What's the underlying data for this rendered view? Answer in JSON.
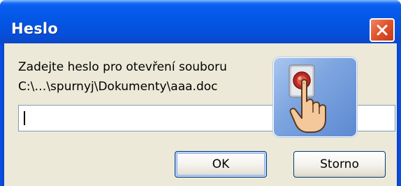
{
  "window": {
    "title": "Heslo"
  },
  "prompt": {
    "line1": "Zadejte heslo pro otevření souboru",
    "line2": "C:\\…\\spurnyj\\Dokumenty\\aaa.doc"
  },
  "password": {
    "value": "",
    "placeholder": ""
  },
  "buttons": {
    "ok_label": "OK",
    "cancel_label": "Storno"
  },
  "icons": {
    "close": "close-icon",
    "hand": "hand-press-icon"
  },
  "colors": {
    "titlebar": "#0458e4",
    "client": "#ece9d8",
    "close_button": "#e2562e",
    "icon_background": "#7ea6e0"
  }
}
